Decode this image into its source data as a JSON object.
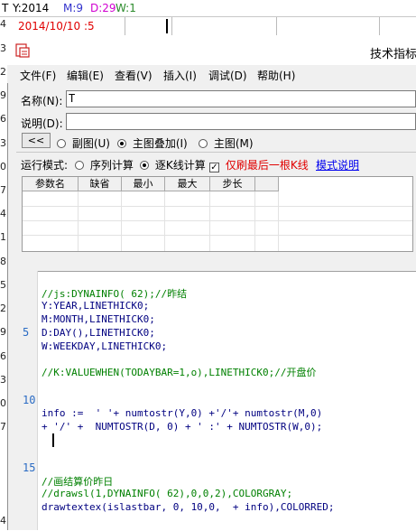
{
  "indicator": {
    "name": "T",
    "y": "Y:2014",
    "m": "M:9",
    "d": "D:29",
    "w": "W:1",
    "date_text": "2014/10/10 :5"
  },
  "left_axis_digits": [
    "4",
    "4",
    "3",
    "2",
    "9",
    "6",
    "3",
    "0",
    "7",
    "4",
    "1",
    "8",
    "5",
    "2",
    "9",
    "6",
    "3",
    "0",
    "7",
    "4"
  ],
  "window": {
    "title": "技术指标",
    "menu": [
      "文件(F)",
      "编辑(E)",
      "查看(V)",
      "插入(I)",
      "调试(D)",
      "帮助(H)"
    ]
  },
  "form": {
    "name_label": "名称(N):",
    "name_value": "T",
    "desc_label": "说明(D):",
    "desc_value": "",
    "back_button": "<<",
    "radio_sub": "副图(U)",
    "radio_overlay": "主图叠加(I)",
    "radio_main": "主图(M)",
    "run_mode_label": "运行模式:",
    "run_seq": "序列计算",
    "run_tick": "逐K线计算",
    "last_bar_only": "仅刷最后一根K线",
    "mode_help": "模式说明"
  },
  "params": {
    "headers": [
      "参数名",
      "缺省",
      "最小",
      "最大",
      "步长"
    ]
  },
  "code": {
    "line_numbers": [
      "5",
      "10",
      "15"
    ],
    "lines": [
      "//js:DYNAINFO( 62);//昨结",
      "Y:YEAR,LINETHICK0;",
      "M:MONTH,LINETHICK0;",
      "D:DAY(),LINETHICK0;",
      "W:WEEKDAY,LINETHICK0;",
      "//K:VALUEWHEN(TODAYBAR=1,o),LINETHICK0;//开盘价",
      "info :=  ' '+ numtostr(Y,0) +'/'+ numtostr(M,0)",
      "+ '/' +  NUMTOSTR(D, 0) + ' :' + NUMTOSTR(W,0);",
      "//画结算价昨日",
      "//drawsl(1,DYNAINFO( 62),0,0,2),COLORGRAY;",
      "drawtextex(islastbar, 0, 10,0,  + info),COLORRED;"
    ]
  },
  "colors": {
    "m_color": "#3333cc",
    "d_color": "#d000d0",
    "w_color": "#2a8a2a",
    "date_color": "#e00000",
    "comment_color": "#008000",
    "keyword_color": "#000080"
  }
}
